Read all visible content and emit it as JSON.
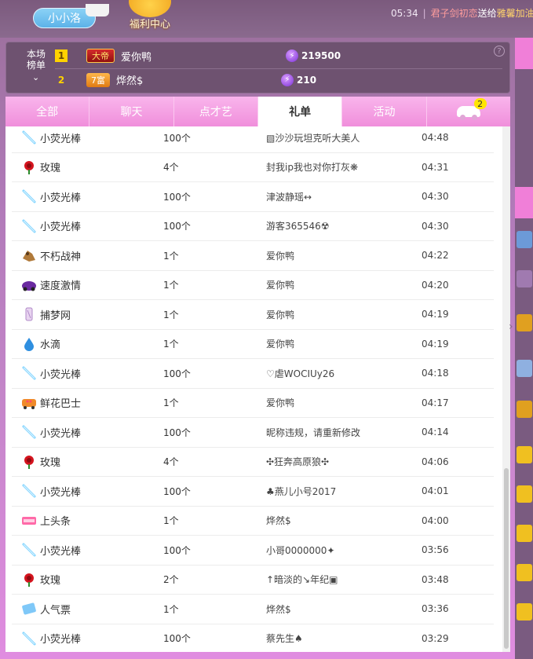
{
  "topbar": {
    "nickname": "小小洛",
    "welfare_label": "福利中心",
    "ticker_time": "05:34",
    "ticker_from": "君子剑初恋",
    "ticker_action": "送给",
    "ticker_to": "雅馨加油"
  },
  "rank": {
    "title_line1": "本场",
    "title_line2": "榜单",
    "chevron": "⌄",
    "help": "?",
    "entries": [
      {
        "num": "1",
        "badge": "大帝",
        "name": "爱你鸭",
        "score": "219500"
      },
      {
        "num": "2",
        "badge": "7富",
        "name": "烨然$",
        "score": "210"
      }
    ]
  },
  "tabs": [
    {
      "label": "全部"
    },
    {
      "label": "聊天"
    },
    {
      "label": "点才艺"
    },
    {
      "label": "礼单"
    },
    {
      "label": "活动"
    }
  ],
  "car_count": "2",
  "gifts": [
    {
      "icon": "glowstick-icon",
      "name": "小荧光棒",
      "qty": "100个",
      "from": "▧沙沙玩坦克听大美人",
      "time": "04:48"
    },
    {
      "icon": "rose-icon",
      "name": "玫瑰",
      "qty": "4个",
      "from": "封我ip我也对你打灰❋",
      "time": "04:31"
    },
    {
      "icon": "glowstick-icon",
      "name": "小荧光棒",
      "qty": "100个",
      "from": "津波静瑶↔",
      "time": "04:30"
    },
    {
      "icon": "glowstick-icon",
      "name": "小荧光棒",
      "qty": "100个",
      "from": "游客365546☢",
      "time": "04:30"
    },
    {
      "icon": "immortal-warrior-icon",
      "name": "不朽战神",
      "qty": "1个",
      "from": "爱你鸭",
      "time": "04:22"
    },
    {
      "icon": "speed-car-icon",
      "name": "速度激情",
      "qty": "1个",
      "from": "爱你鸭",
      "time": "04:20"
    },
    {
      "icon": "dreamcatcher-icon",
      "name": "捕梦网",
      "qty": "1个",
      "from": "爱你鸭",
      "time": "04:19"
    },
    {
      "icon": "water-drop-icon",
      "name": "水滴",
      "qty": "1个",
      "from": "爱你鸭",
      "time": "04:19"
    },
    {
      "icon": "glowstick-icon",
      "name": "小荧光棒",
      "qty": "100个",
      "from": "♡虐WOCIUy26",
      "time": "04:18"
    },
    {
      "icon": "flower-bus-icon",
      "name": "鲜花巴士",
      "qty": "1个",
      "from": "爱你鸭",
      "time": "04:17"
    },
    {
      "icon": "glowstick-icon",
      "name": "小荧光棒",
      "qty": "100个",
      "from": "昵称违规，请重新修改",
      "time": "04:14"
    },
    {
      "icon": "rose-icon",
      "name": "玫瑰",
      "qty": "4个",
      "from": "✣狂奔高原狼✣",
      "time": "04:06"
    },
    {
      "icon": "glowstick-icon",
      "name": "小荧光棒",
      "qty": "100个",
      "from": "♣燕儿小号2017",
      "time": "04:01"
    },
    {
      "icon": "headline-icon",
      "name": "上头条",
      "qty": "1个",
      "from": "烨然$",
      "time": "04:00"
    },
    {
      "icon": "glowstick-icon",
      "name": "小荧光棒",
      "qty": "100个",
      "from": "小哥0000000✦",
      "time": "03:56"
    },
    {
      "icon": "rose-icon",
      "name": "玫瑰",
      "qty": "2个",
      "from": "↑暗淡的↘年纪▣",
      "time": "03:48"
    },
    {
      "icon": "popularity-ticket-icon",
      "name": "人气票",
      "qty": "1个",
      "from": "烨然$",
      "time": "03:36"
    },
    {
      "icon": "glowstick-icon",
      "name": "小荧光棒",
      "qty": "100个",
      "from": "蔡先生♠",
      "time": "03:29"
    }
  ],
  "colors": {
    "tab_pink": "#f08fdb",
    "rank_bg": "#6e5270",
    "gold": "#ffd200"
  }
}
